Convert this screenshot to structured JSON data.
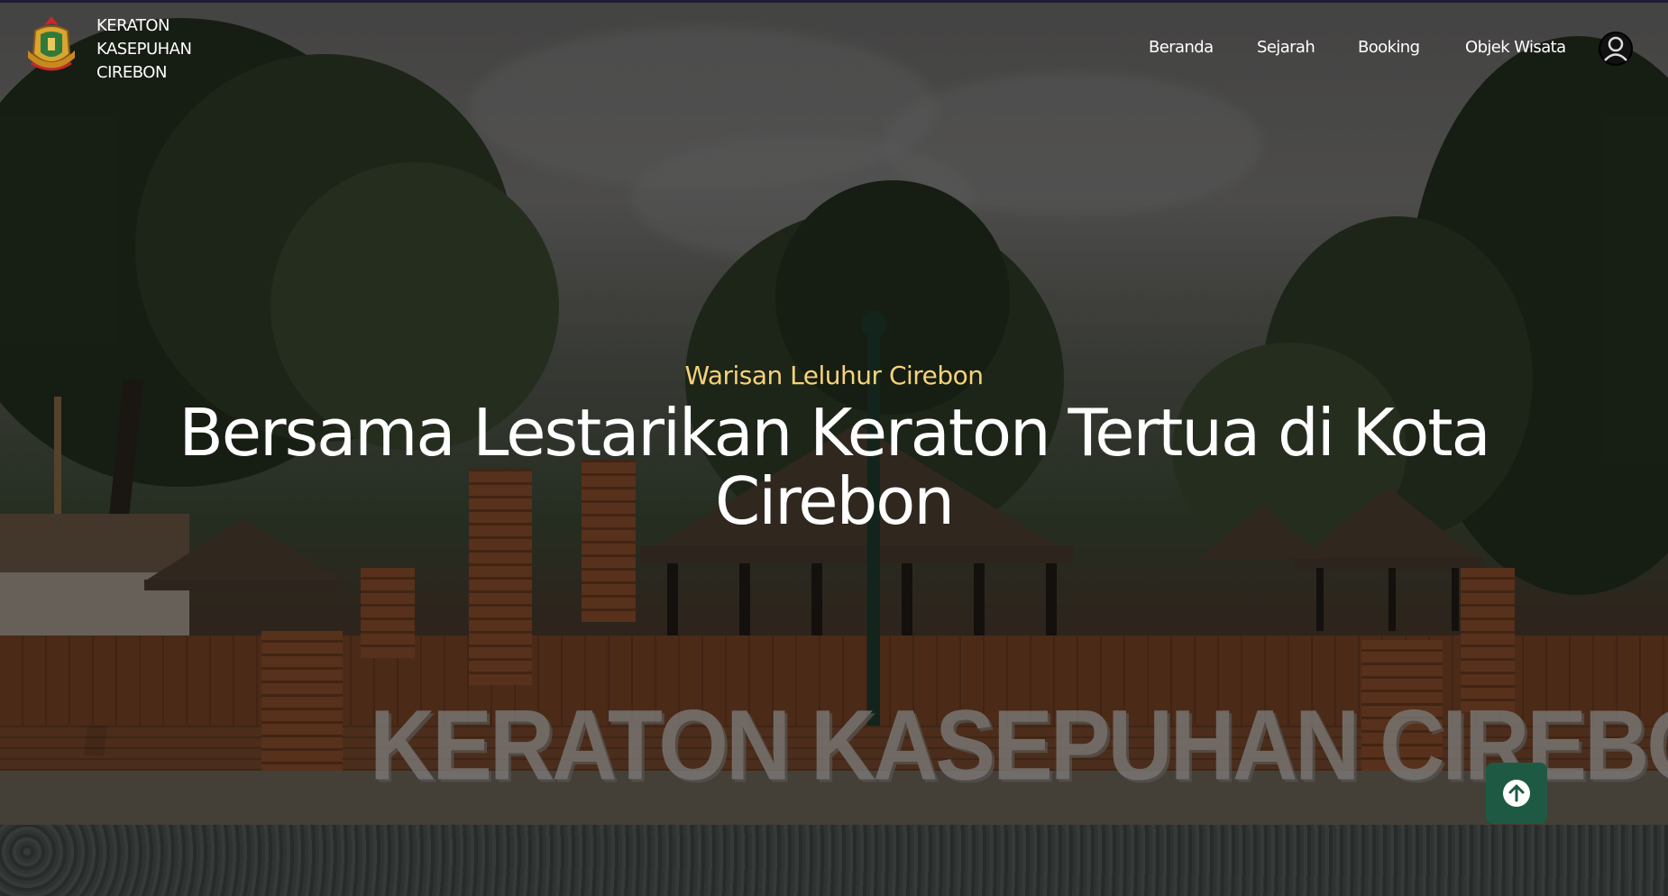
{
  "header": {
    "brand_lines": [
      "KERATON",
      "KASEPUHAN",
      "CIREBON"
    ],
    "logo_icon": "keraton-crest-logo",
    "nav": [
      {
        "label": "Beranda"
      },
      {
        "label": "Sejarah"
      },
      {
        "label": "Booking"
      },
      {
        "label": "Objek Wisata"
      }
    ],
    "profile_icon": "user-circle-icon"
  },
  "hero": {
    "eyebrow": "Warisan Leluhur Cirebon",
    "headline": "Bersama Lestarikan Keraton Tertua di Kota Cirebon",
    "sign_text": "KERATON KASEPUHAN CIREBON"
  },
  "scroll_top": {
    "icon": "arrow-up-circle-icon"
  },
  "colors": {
    "accent_gold": "#f4d37a",
    "button_green": "#1e5a43",
    "nav_text": "#ffffff",
    "top_bar": "#1f1c3a"
  }
}
